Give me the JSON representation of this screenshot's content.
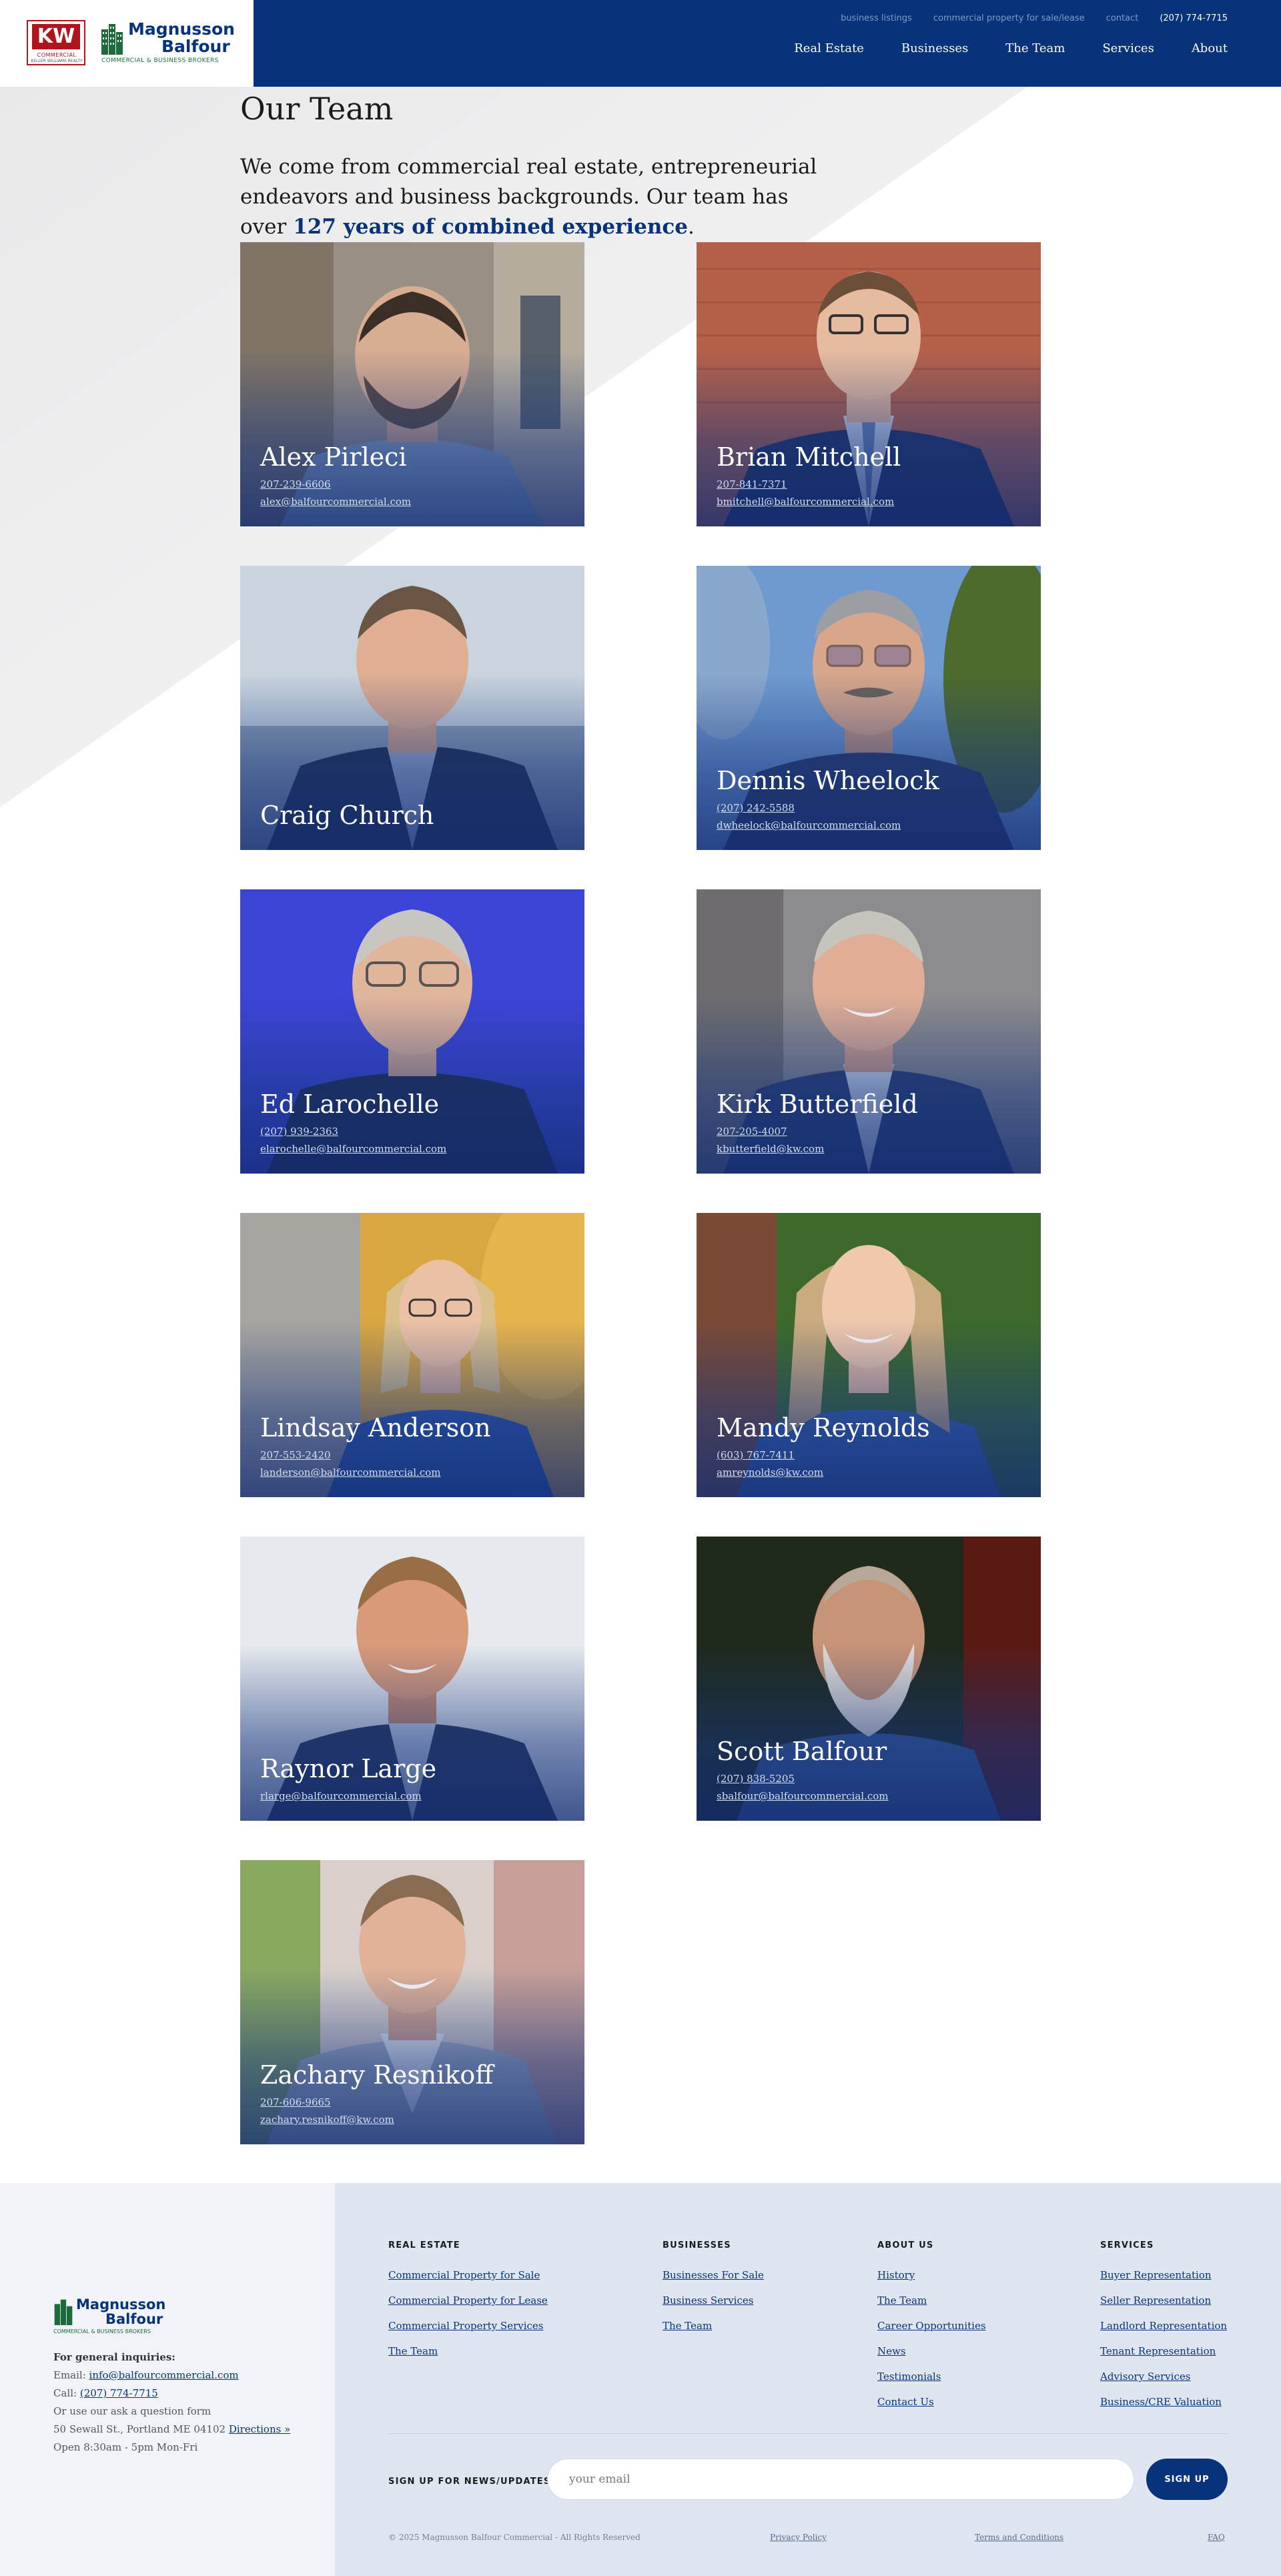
{
  "header": {
    "util_nav": [
      "business listings",
      "commercial property for sale/lease",
      "contact"
    ],
    "phone": "(207) 774-7715",
    "main_nav": [
      "Real Estate",
      "Businesses",
      "The Team",
      "Services",
      "About"
    ],
    "kw_logo": {
      "text": "KW",
      "sub": "COMMERCIAL",
      "sub2": "KELLER WILLIAMS REALTY"
    },
    "mb_logo": {
      "line1": "Magnusson",
      "line2": "Balfour",
      "tagline": "COMMERCIAL & BUSINESS BROKERS"
    }
  },
  "intro": {
    "title": "Our Team",
    "text": "We come from commercial real estate, entrepreneurial endeavors and business backgrounds. Our team has over ",
    "highlight": "127 years of combined experience",
    "end": "."
  },
  "team": [
    {
      "name": "Alex Pirleci",
      "phone": "207-239-6606",
      "email": "alex@balfourcommercial.com"
    },
    {
      "name": "Brian Mitchell",
      "phone": "207-841-7371",
      "email": "bmitchell@balfourcommercial.com"
    },
    {
      "name": "Craig Church",
      "phone": "",
      "email": ""
    },
    {
      "name": "Dennis Wheelock",
      "phone": "(207) 242-5588",
      "email": "dwheelock@balfourcommercial.com"
    },
    {
      "name": "Ed Larochelle",
      "phone": "(207) 939-2363",
      "email": "elarochelle@balfourcommercial.com"
    },
    {
      "name": "Kirk Butterfield",
      "phone": "207-205-4007",
      "email": "kbutterfield@kw.com"
    },
    {
      "name": "Lindsay Anderson",
      "phone": "207-553-2420",
      "email": "landerson@balfourcommercial.com"
    },
    {
      "name": "Mandy Reynolds",
      "phone": "(603) 767-7411",
      "email": "amreynolds@kw.com"
    },
    {
      "name": "Raynor Large",
      "phone": "",
      "email": "rlarge@balfourcommercial.com"
    },
    {
      "name": "Scott Balfour",
      "phone": "(207) 838-5205",
      "email": "sbalfour@balfourcommercial.com"
    },
    {
      "name": "Zachary Resnikoff",
      "phone": "207-606-9665",
      "email": "zachary.resnikoff@kw.com"
    }
  ],
  "footer": {
    "inquiries_label": "For general inquiries:",
    "email_label": "Email: ",
    "email": "info@balfourcommercial.com",
    "call_label": "Call: ",
    "phone": "(207) 774-7715",
    "question": "Or use our ask a question form",
    "address": "50 Sewall St., Portland ME 04102 ",
    "directions": "Directions »",
    "hours": "Open 8:30am - 5pm Mon-Fri",
    "columns": [
      {
        "heading": "REAL ESTATE",
        "links": [
          "Commercial Property for Sale",
          "Commercial Property for Lease",
          "Commercial Property Services",
          "The Team"
        ]
      },
      {
        "heading": "BUSINESSES",
        "links": [
          "Businesses For Sale",
          "Business Services",
          "The Team"
        ]
      },
      {
        "heading": "ABOUT US",
        "links": [
          "History",
          "The Team",
          "Career Opportunities",
          "News",
          "Testimonials",
          "Contact Us"
        ]
      },
      {
        "heading": "SERVICES",
        "links": [
          "Buyer Representation",
          "Seller Representation",
          "Landlord Representation",
          "Tenant Representation",
          "Advisory Services",
          "Business/CRE Valuation"
        ]
      }
    ],
    "signup_label": "SIGN UP FOR NEWS/UPDATES",
    "signup_placeholder": "your email",
    "signup_button": "SIGN UP",
    "copyright": "© 2025 Magnusson Balfour Commercial - All Rights Reserved",
    "privacy": "Privacy Policy",
    "terms": "Terms and Conditions",
    "faq": "FAQ"
  },
  "colors": {
    "brand_blue": "#07337a",
    "kw_red": "#b0151e",
    "footer_bg": "#dfe6f2"
  }
}
